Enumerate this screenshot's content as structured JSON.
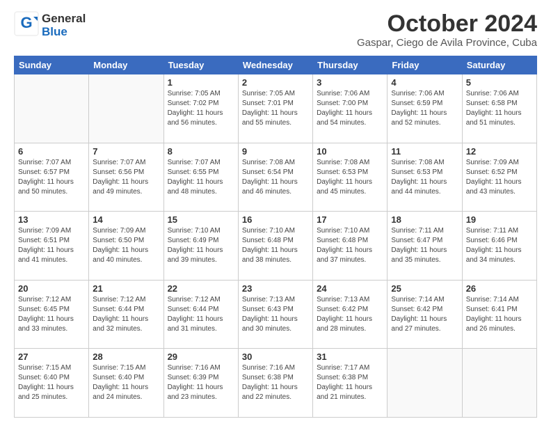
{
  "logo": {
    "general": "General",
    "blue": "Blue"
  },
  "header": {
    "month": "October 2024",
    "location": "Gaspar, Ciego de Avila Province, Cuba"
  },
  "weekdays": [
    "Sunday",
    "Monday",
    "Tuesday",
    "Wednesday",
    "Thursday",
    "Friday",
    "Saturday"
  ],
  "weeks": [
    [
      {
        "day": "",
        "sunrise": "",
        "sunset": "",
        "daylight": ""
      },
      {
        "day": "",
        "sunrise": "",
        "sunset": "",
        "daylight": ""
      },
      {
        "day": "1",
        "sunrise": "Sunrise: 7:05 AM",
        "sunset": "Sunset: 7:02 PM",
        "daylight": "Daylight: 11 hours and 56 minutes."
      },
      {
        "day": "2",
        "sunrise": "Sunrise: 7:05 AM",
        "sunset": "Sunset: 7:01 PM",
        "daylight": "Daylight: 11 hours and 55 minutes."
      },
      {
        "day": "3",
        "sunrise": "Sunrise: 7:06 AM",
        "sunset": "Sunset: 7:00 PM",
        "daylight": "Daylight: 11 hours and 54 minutes."
      },
      {
        "day": "4",
        "sunrise": "Sunrise: 7:06 AM",
        "sunset": "Sunset: 6:59 PM",
        "daylight": "Daylight: 11 hours and 52 minutes."
      },
      {
        "day": "5",
        "sunrise": "Sunrise: 7:06 AM",
        "sunset": "Sunset: 6:58 PM",
        "daylight": "Daylight: 11 hours and 51 minutes."
      }
    ],
    [
      {
        "day": "6",
        "sunrise": "Sunrise: 7:07 AM",
        "sunset": "Sunset: 6:57 PM",
        "daylight": "Daylight: 11 hours and 50 minutes."
      },
      {
        "day": "7",
        "sunrise": "Sunrise: 7:07 AM",
        "sunset": "Sunset: 6:56 PM",
        "daylight": "Daylight: 11 hours and 49 minutes."
      },
      {
        "day": "8",
        "sunrise": "Sunrise: 7:07 AM",
        "sunset": "Sunset: 6:55 PM",
        "daylight": "Daylight: 11 hours and 48 minutes."
      },
      {
        "day": "9",
        "sunrise": "Sunrise: 7:08 AM",
        "sunset": "Sunset: 6:54 PM",
        "daylight": "Daylight: 11 hours and 46 minutes."
      },
      {
        "day": "10",
        "sunrise": "Sunrise: 7:08 AM",
        "sunset": "Sunset: 6:53 PM",
        "daylight": "Daylight: 11 hours and 45 minutes."
      },
      {
        "day": "11",
        "sunrise": "Sunrise: 7:08 AM",
        "sunset": "Sunset: 6:53 PM",
        "daylight": "Daylight: 11 hours and 44 minutes."
      },
      {
        "day": "12",
        "sunrise": "Sunrise: 7:09 AM",
        "sunset": "Sunset: 6:52 PM",
        "daylight": "Daylight: 11 hours and 43 minutes."
      }
    ],
    [
      {
        "day": "13",
        "sunrise": "Sunrise: 7:09 AM",
        "sunset": "Sunset: 6:51 PM",
        "daylight": "Daylight: 11 hours and 41 minutes."
      },
      {
        "day": "14",
        "sunrise": "Sunrise: 7:09 AM",
        "sunset": "Sunset: 6:50 PM",
        "daylight": "Daylight: 11 hours and 40 minutes."
      },
      {
        "day": "15",
        "sunrise": "Sunrise: 7:10 AM",
        "sunset": "Sunset: 6:49 PM",
        "daylight": "Daylight: 11 hours and 39 minutes."
      },
      {
        "day": "16",
        "sunrise": "Sunrise: 7:10 AM",
        "sunset": "Sunset: 6:48 PM",
        "daylight": "Daylight: 11 hours and 38 minutes."
      },
      {
        "day": "17",
        "sunrise": "Sunrise: 7:10 AM",
        "sunset": "Sunset: 6:48 PM",
        "daylight": "Daylight: 11 hours and 37 minutes."
      },
      {
        "day": "18",
        "sunrise": "Sunrise: 7:11 AM",
        "sunset": "Sunset: 6:47 PM",
        "daylight": "Daylight: 11 hours and 35 minutes."
      },
      {
        "day": "19",
        "sunrise": "Sunrise: 7:11 AM",
        "sunset": "Sunset: 6:46 PM",
        "daylight": "Daylight: 11 hours and 34 minutes."
      }
    ],
    [
      {
        "day": "20",
        "sunrise": "Sunrise: 7:12 AM",
        "sunset": "Sunset: 6:45 PM",
        "daylight": "Daylight: 11 hours and 33 minutes."
      },
      {
        "day": "21",
        "sunrise": "Sunrise: 7:12 AM",
        "sunset": "Sunset: 6:44 PM",
        "daylight": "Daylight: 11 hours and 32 minutes."
      },
      {
        "day": "22",
        "sunrise": "Sunrise: 7:12 AM",
        "sunset": "Sunset: 6:44 PM",
        "daylight": "Daylight: 11 hours and 31 minutes."
      },
      {
        "day": "23",
        "sunrise": "Sunrise: 7:13 AM",
        "sunset": "Sunset: 6:43 PM",
        "daylight": "Daylight: 11 hours and 30 minutes."
      },
      {
        "day": "24",
        "sunrise": "Sunrise: 7:13 AM",
        "sunset": "Sunset: 6:42 PM",
        "daylight": "Daylight: 11 hours and 28 minutes."
      },
      {
        "day": "25",
        "sunrise": "Sunrise: 7:14 AM",
        "sunset": "Sunset: 6:42 PM",
        "daylight": "Daylight: 11 hours and 27 minutes."
      },
      {
        "day": "26",
        "sunrise": "Sunrise: 7:14 AM",
        "sunset": "Sunset: 6:41 PM",
        "daylight": "Daylight: 11 hours and 26 minutes."
      }
    ],
    [
      {
        "day": "27",
        "sunrise": "Sunrise: 7:15 AM",
        "sunset": "Sunset: 6:40 PM",
        "daylight": "Daylight: 11 hours and 25 minutes."
      },
      {
        "day": "28",
        "sunrise": "Sunrise: 7:15 AM",
        "sunset": "Sunset: 6:40 PM",
        "daylight": "Daylight: 11 hours and 24 minutes."
      },
      {
        "day": "29",
        "sunrise": "Sunrise: 7:16 AM",
        "sunset": "Sunset: 6:39 PM",
        "daylight": "Daylight: 11 hours and 23 minutes."
      },
      {
        "day": "30",
        "sunrise": "Sunrise: 7:16 AM",
        "sunset": "Sunset: 6:38 PM",
        "daylight": "Daylight: 11 hours and 22 minutes."
      },
      {
        "day": "31",
        "sunrise": "Sunrise: 7:17 AM",
        "sunset": "Sunset: 6:38 PM",
        "daylight": "Daylight: 11 hours and 21 minutes."
      },
      {
        "day": "",
        "sunrise": "",
        "sunset": "",
        "daylight": ""
      },
      {
        "day": "",
        "sunrise": "",
        "sunset": "",
        "daylight": ""
      }
    ]
  ]
}
